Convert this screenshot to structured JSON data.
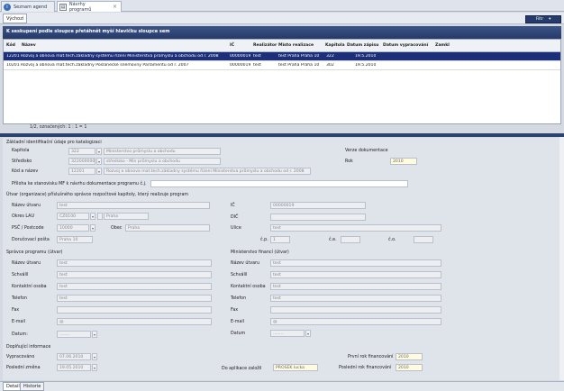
{
  "tabs": [
    {
      "label": "Seznam agend",
      "icon": "info-icon"
    },
    {
      "label": "Návrhy programů",
      "icon": "document-icon"
    }
  ],
  "subtab": "Výchozí",
  "filter_label": "Filtr",
  "group_banner": "K seskupení podle sloupce přetáhnět myší hlavičku sloupce sem",
  "columns": [
    "Kód",
    "Název",
    "IČ",
    "Realizátor",
    "Místo realizace",
    "Kapitola",
    "Datum zápisu",
    "Datum vypracování",
    "Zamkl"
  ],
  "rows": [
    {
      "kod": "12201",
      "nazev": "Rozvoj a obnova mat.tech.základny systému řízení Ministerstva průmyslu a obchodu od r. 2008",
      "ic": "00000019",
      "realizator": "test",
      "misto": "test Praha Praha 10",
      "kapitola": "322",
      "zapis": "19.5.2010",
      "vypracovani": "",
      "zamkl": ""
    },
    {
      "kod": "10201",
      "nazev": "Rozvoj a obnova mat.tech.základny Poslanecké sněmovny Parlamentu od r. 2007",
      "ic": "00000019",
      "realizator": "test",
      "misto": "test Praha Praha 10",
      "kapitola": "302",
      "zapis": "19.5.2010",
      "vypracovani": "",
      "zamkl": ""
    }
  ],
  "grid_footer": "1/2, označených: 1 : 1 = 1",
  "basic": {
    "title": "Základní identifikační údaje pro katalogizaci",
    "kapitola_label": "Kapitola",
    "kapitola_code": "322",
    "kapitola_name": "Ministerstvo průmyslu a obchodu",
    "stredisko_label": "Středisko",
    "stredisko_code": "322000000",
    "stredisko_name": "středisko - Min průmyslu a obchodu",
    "kod_label": "Kód a název",
    "kod_code": "12201",
    "kod_name": "Rozvoj a obnova mat.tech.základny systému řízení Ministerstva průmyslu a obchodu od r. 2008",
    "priloha_label": "Příloha ke stanovisku MF k návrhu dokumentace programu č.j.",
    "verze_label": "Verze dokumentace",
    "rok_label": "Rok",
    "rok_value": "2010"
  },
  "spravce": {
    "title": "Útvar (organizace) příslušného správce rozpočtové kapitoly, který realizuje program",
    "nazev_label": "Název útvaru",
    "nazev_value": "test",
    "okres_label": "Okres LAU",
    "okres_code": "CZ0100",
    "okres_name": "Praha",
    "psc_label": "PSČ / Postcode",
    "psc_value": "10000",
    "obec_label": "Obec",
    "obec_value": "Praha",
    "posta_label": "Doručovací pošta",
    "posta_value": "Praha 10",
    "ic_label": "IČ",
    "ic_value": "00000019",
    "dic_label": "DIČ",
    "ulice_label": "Ulice",
    "ulice_value": "test",
    "cp_label": "č.p.",
    "cp_value": "1",
    "ce_label": "č.e.",
    "co_label": "č.o."
  },
  "programu": {
    "title": "Správce programu (útvar)",
    "nazev_label": "Název útvaru",
    "nazev_value": "test",
    "schvalil_label": "Schválil",
    "schvalil_value": "test",
    "kontakt_label": "Kontaktní osoba",
    "kontakt_value": "test",
    "telefon_label": "Telefon",
    "telefon_value": "test",
    "fax_label": "Fax",
    "email_label": "E-mail",
    "email_value": "@",
    "datum_label": "Datum:",
    "datum_value": "........"
  },
  "mf": {
    "title": "Ministerstvo financí (útvar)",
    "nazev_label": "Název útvaru",
    "nazev_value": "test",
    "schvalil_label": "Schválil",
    "schvalil_value": "test",
    "kontakt_label": "Kontaktní osoba",
    "kontakt_value": "test",
    "telefon_label": "Telefon",
    "telefon_value": "test",
    "fax_label": "Fax",
    "email_label": "E-mail",
    "email_value": "@",
    "datum_label": "Datum",
    "datum_value": "........"
  },
  "extra": {
    "title": "Doplňující informace",
    "vypracovano_label": "Vypracováno",
    "vypracovano_value": "07.06.2010",
    "zmena_label": "Poslední změna",
    "zmena_value": "19.05.2010",
    "aplikace_label": "Do aplikace založil",
    "aplikace_value": "PROSEK lucka",
    "prvni_label": "První rok financování",
    "prvni_value": "2010",
    "posledni_label": "Poslední rok financování",
    "posledni_value": "2010"
  },
  "bottom_tabs": [
    "Detail",
    "Historie"
  ]
}
